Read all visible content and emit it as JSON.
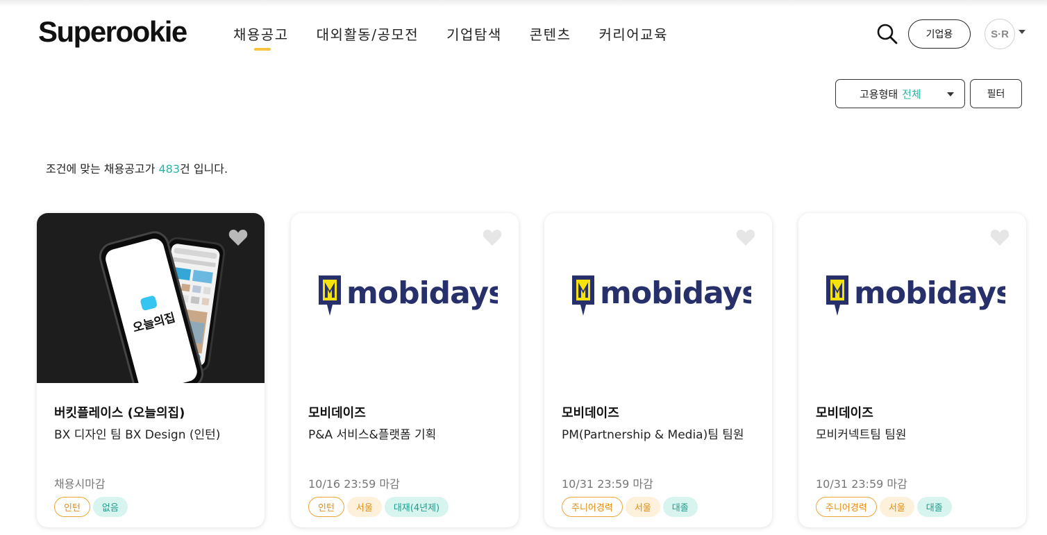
{
  "header": {
    "logo": "Superookie",
    "nav": [
      {
        "label": "채용공고",
        "active": true
      },
      {
        "label": "대외활동/공모전",
        "active": false
      },
      {
        "label": "기업탐색",
        "active": false
      },
      {
        "label": "콘텐츠",
        "active": false
      },
      {
        "label": "커리어교육",
        "active": false
      }
    ],
    "search_icon": "search-icon",
    "business_button": "기업용",
    "avatar_initials": "S·R"
  },
  "filters": {
    "employment_label": "고용형태",
    "employment_value": "전체",
    "filter_button": "필터",
    "accent_color": "#2bb3a3"
  },
  "result": {
    "prefix": "조건에 맞는 채용공고가 ",
    "count": "483",
    "suffix": "건 입니다."
  },
  "cards": [
    {
      "image": "ohou-app-phones",
      "image_text": "오늘의집",
      "company": "버킷플레이스 (오늘의집)",
      "position": "BX 디자인 팀 BX Design (인턴)",
      "deadline": "채용시마감",
      "tags": [
        {
          "label": "인턴",
          "style": "outline"
        },
        {
          "label": "없음",
          "style": "mint"
        }
      ]
    },
    {
      "image": "mobidays-logo",
      "logo_text": "mobidays",
      "company": "모비데이즈",
      "position": "P&A 서비스&플랫폼 기획",
      "deadline": "10/16 23:59 마감",
      "tags": [
        {
          "label": "인턴",
          "style": "outline"
        },
        {
          "label": "서울",
          "style": "peach"
        },
        {
          "label": "대재(4년제)",
          "style": "mint"
        }
      ]
    },
    {
      "image": "mobidays-logo",
      "logo_text": "mobidays",
      "company": "모비데이즈",
      "position": "PM(Partnership & Media)팀 팀원",
      "deadline": "10/31 23:59 마감",
      "tags": [
        {
          "label": "주니어경력",
          "style": "outline"
        },
        {
          "label": "서울",
          "style": "peach"
        },
        {
          "label": "대졸",
          "style": "mint"
        }
      ]
    },
    {
      "image": "mobidays-logo",
      "logo_text": "mobidays",
      "company": "모비데이즈",
      "position": "모비커넥트팀 팀원",
      "deadline": "10/31 23:59 마감",
      "tags": [
        {
          "label": "주니어경력",
          "style": "outline"
        },
        {
          "label": "서울",
          "style": "peach"
        },
        {
          "label": "대졸",
          "style": "mint"
        }
      ]
    }
  ]
}
